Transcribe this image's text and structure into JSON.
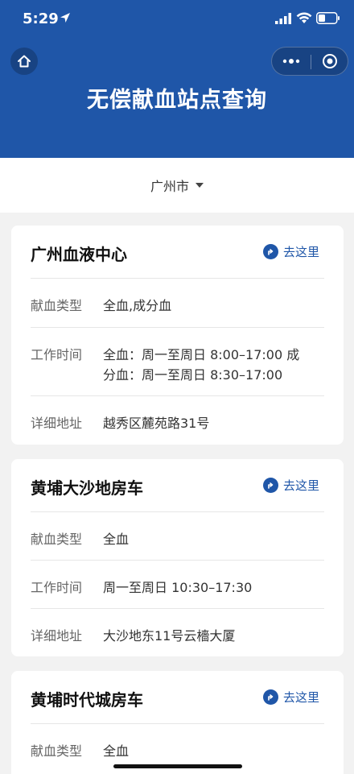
{
  "status_bar": {
    "time": "5:29"
  },
  "header": {
    "title": "无偿献血站点查询"
  },
  "city_selector": {
    "label": "广州市"
  },
  "labels": {
    "blood_type": "献血类型",
    "work_time": "工作时间",
    "address": "详细地址",
    "go_here": "去这里"
  },
  "stations": [
    {
      "name": "广州血液中心",
      "blood_type": "全血,成分血",
      "work_time_line1": "全血：周一至周日 8:00–17:00 成",
      "work_time_line2": "分血：周一至周日 8:30–17:00",
      "address": "越秀区麓苑路31号"
    },
    {
      "name": "黄埔大沙地房车",
      "blood_type": "全血",
      "work_time_line1": "周一至周日 10:30–17:30",
      "address": "大沙地东11号云檣大厦"
    },
    {
      "name": "黄埔时代城房车",
      "blood_type": "全血"
    }
  ],
  "colors": {
    "brand": "#1f56a8",
    "background": "#f2f2f2"
  }
}
